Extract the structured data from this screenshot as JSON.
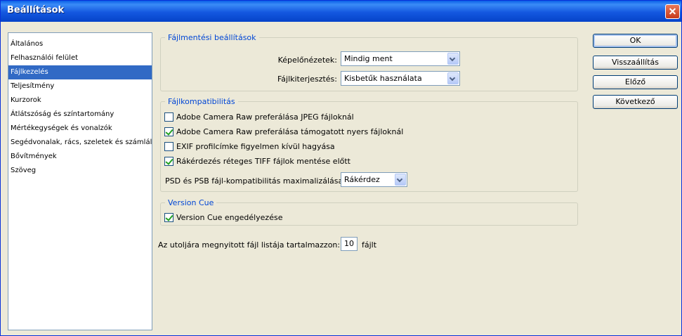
{
  "window": {
    "title": "Beállítások"
  },
  "sidebar": {
    "items": [
      {
        "label": "Általános"
      },
      {
        "label": "Felhasználói felület"
      },
      {
        "label": "Fájlkezelés",
        "selected": true
      },
      {
        "label": "Teljesítmény"
      },
      {
        "label": "Kurzorok"
      },
      {
        "label": "Átlátszóság és színtartomány"
      },
      {
        "label": "Mértékegységek és vonalzók"
      },
      {
        "label": "Segédvonalak, rács, szeletek és számlálás"
      },
      {
        "label": "Bővítmények"
      },
      {
        "label": "Szöveg"
      }
    ]
  },
  "file_save": {
    "legend": "Fájlmentési beállítások",
    "previews_label": "Képelőnézetek:",
    "previews_value": "Mindig ment",
    "extension_label": "Fájlkiterjesztés:",
    "extension_value": "Kisbetűk használata"
  },
  "compat": {
    "legend": "Fájlkompatibilitás",
    "options": [
      {
        "label": "Adobe Camera Raw preferálása JPEG fájloknál",
        "checked": false
      },
      {
        "label": "Adobe Camera Raw preferálása támogatott nyers fájloknál",
        "checked": true
      },
      {
        "label": "EXIF profilcímke figyelmen kívül hagyása",
        "checked": false
      },
      {
        "label": "Rákérdezés réteges TIFF fájlok mentése előtt",
        "checked": true
      }
    ],
    "maximize_label": "PSD és PSB fájl-kompatibilitás maximalizálása:",
    "maximize_value": "Rákérdez"
  },
  "version_cue": {
    "legend": "Version Cue",
    "enable_label": "Version Cue engedélyezése",
    "enable_checked": true
  },
  "recent": {
    "label_before": "Az utoljára megnyitott fájl listája tartalmazzon:",
    "value": "10",
    "label_after": "fájlt"
  },
  "buttons": {
    "ok": "OK",
    "reset": "Visszaállítás",
    "prev": "Előző",
    "next": "Következő"
  }
}
